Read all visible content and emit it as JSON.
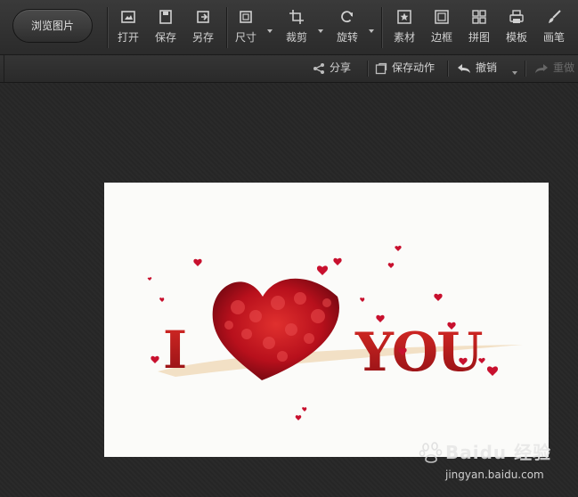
{
  "toolbar": {
    "browse_label": "浏览图片",
    "tools": {
      "open": "打开",
      "save": "保存",
      "save_as": "另存",
      "size": "尺寸",
      "crop": "裁剪",
      "rotate": "旋转",
      "material": "素材",
      "border": "边框",
      "collage": "拼图",
      "template": "模板",
      "brush": "画笔"
    }
  },
  "subbar": {
    "share": "分享",
    "save_action": "保存动作",
    "undo": "撤销",
    "redo": "重做"
  },
  "image": {
    "text_i": "I",
    "text_you": "YOU"
  },
  "watermark": {
    "brand": "Baidu 经验",
    "url": "jingyan.baidu.com"
  },
  "colors": {
    "toolbar_bg": "#333333",
    "canvas_bg": "#262626",
    "rose_red": "#c8102e",
    "letter_red": "#b51a1f"
  }
}
